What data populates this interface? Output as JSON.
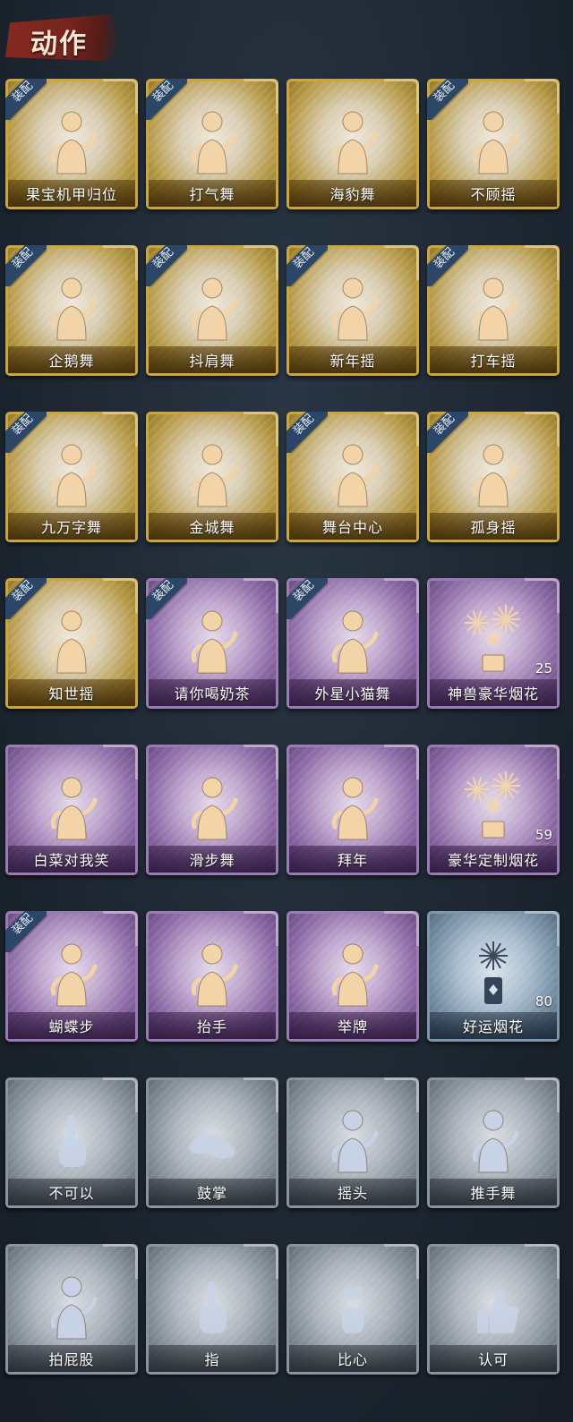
{
  "header": {
    "title": "动作"
  },
  "equip_label": "装配",
  "colors": {
    "gold": "#c9a640",
    "purple": "#9b7bb3",
    "blue": "#7f97ad",
    "gray": "#8b949c",
    "badge": "#2b4666"
  },
  "items": [
    {
      "name": "果宝机甲归位",
      "tier": "gold",
      "equipped": true,
      "icon": "character-dance-icon"
    },
    {
      "name": "打气舞",
      "tier": "gold",
      "equipped": true,
      "icon": "character-dance-icon"
    },
    {
      "name": "海豹舞",
      "tier": "gold",
      "equipped": false,
      "icon": "character-dance-icon"
    },
    {
      "name": "不顾摇",
      "tier": "gold",
      "equipped": true,
      "icon": "character-dance-icon"
    },
    {
      "name": "企鹅舞",
      "tier": "gold",
      "equipped": true,
      "icon": "character-dance-icon"
    },
    {
      "name": "抖肩舞",
      "tier": "gold",
      "equipped": true,
      "icon": "character-dance-icon"
    },
    {
      "name": "新年摇",
      "tier": "gold",
      "equipped": true,
      "icon": "character-dance-icon"
    },
    {
      "name": "打车摇",
      "tier": "gold",
      "equipped": true,
      "icon": "character-dance-icon"
    },
    {
      "name": "九万字舞",
      "tier": "gold",
      "equipped": true,
      "icon": "character-dance-icon"
    },
    {
      "name": "金城舞",
      "tier": "gold",
      "equipped": false,
      "icon": "character-dance-icon"
    },
    {
      "name": "舞台中心",
      "tier": "gold",
      "equipped": true,
      "icon": "character-dance-icon"
    },
    {
      "name": "孤身摇",
      "tier": "gold",
      "equipped": true,
      "icon": "character-dance-icon"
    },
    {
      "name": "知世摇",
      "tier": "gold",
      "equipped": true,
      "icon": "character-dance-icon"
    },
    {
      "name": "请你喝奶茶",
      "tier": "purple",
      "equipped": true,
      "icon": "character-sign-icon"
    },
    {
      "name": "外星小猫舞",
      "tier": "purple",
      "equipped": true,
      "icon": "character-dance-icon"
    },
    {
      "name": "神兽豪华烟花",
      "tier": "purple",
      "equipped": false,
      "icon": "fireworks-icon",
      "count": "25"
    },
    {
      "name": "白菜对我笑",
      "tier": "purple",
      "equipped": false,
      "icon": "character-dance-icon"
    },
    {
      "name": "滑步舞",
      "tier": "purple",
      "equipped": false,
      "icon": "character-dance-icon"
    },
    {
      "name": "拜年",
      "tier": "purple",
      "equipped": false,
      "icon": "character-bow-icon"
    },
    {
      "name": "豪华定制烟花",
      "tier": "purple",
      "equipped": false,
      "icon": "fireworks-icon",
      "count": "59"
    },
    {
      "name": "蝴蝶步",
      "tier": "purple",
      "equipped": true,
      "icon": "character-dance-icon"
    },
    {
      "name": "抬手",
      "tier": "purple",
      "equipped": false,
      "icon": "character-wave-icon"
    },
    {
      "name": "举牌",
      "tier": "purple",
      "equipped": false,
      "icon": "character-sign-icon"
    },
    {
      "name": "好运烟花",
      "tier": "blue",
      "equipped": false,
      "icon": "firework-tube-icon",
      "count": "80"
    },
    {
      "name": "不可以",
      "tier": "gray",
      "equipped": false,
      "icon": "finger-wag-icon"
    },
    {
      "name": "鼓掌",
      "tier": "gray",
      "equipped": false,
      "icon": "clap-hands-icon"
    },
    {
      "name": "摇头",
      "tier": "gray",
      "equipped": false,
      "icon": "character-shake-icon"
    },
    {
      "name": "推手舞",
      "tier": "gray",
      "equipped": false,
      "icon": "character-dance-icon"
    },
    {
      "name": "拍屁股",
      "tier": "gray",
      "equipped": false,
      "icon": "character-dance-icon"
    },
    {
      "name": "指",
      "tier": "gray",
      "equipped": false,
      "icon": "pointing-hand-icon"
    },
    {
      "name": "比心",
      "tier": "gray",
      "equipped": false,
      "icon": "finger-heart-icon"
    },
    {
      "name": "认可",
      "tier": "gray",
      "equipped": false,
      "icon": "thumbs-up-icon"
    }
  ]
}
